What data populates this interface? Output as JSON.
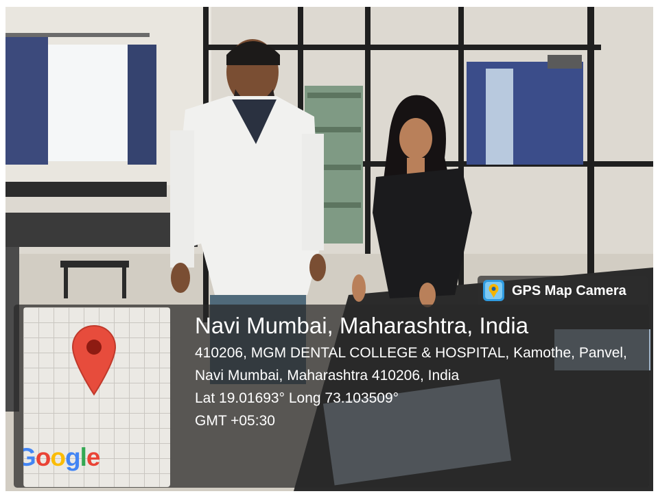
{
  "badge": {
    "label": "GPS Map Camera",
    "icon": "gps-map-camera-app-icon"
  },
  "location": {
    "title": "Navi Mumbai, Maharashtra, India",
    "address": "410206, MGM DENTAL COLLEGE & HOSPITAL, Kamothe, Panvel, Navi Mumbai, Maharashtra 410206, India",
    "coordinates": "Lat 19.01693° Long 73.103509°",
    "timezone": "GMT +05:30"
  },
  "map": {
    "pin_icon": "map-pin-icon",
    "logo": "Google",
    "logo_colors": [
      "#4285f4",
      "#ea4335",
      "#fbbc05",
      "#4285f4",
      "#34a853",
      "#ea4335"
    ]
  },
  "colors": {
    "pin": "#e74c3c",
    "panel": "rgba(40,40,40,0.72)",
    "text": "#ffffff"
  }
}
